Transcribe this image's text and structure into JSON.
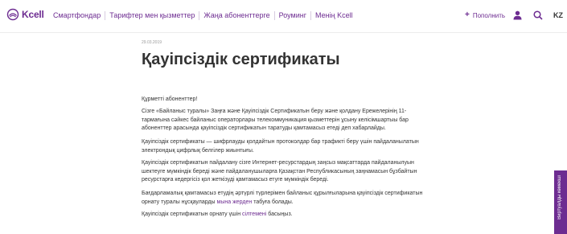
{
  "header": {
    "logo_text": "Kcell",
    "nav": [
      "Смартфондар",
      "Тарифтер мен қызметтер",
      "Жаңа абоненттерге",
      "Роуминг",
      "Менің Kcell"
    ],
    "replenish_label": "Пополнить",
    "replenish_icon": "plus-icon",
    "user_icon": "user-icon",
    "search_icon": "search-icon",
    "language": "KZ"
  },
  "article": {
    "date": "29.03.2019",
    "title": "Қауіпсіздік сертификаты",
    "greeting": "Құрметті абоненттер!",
    "p1": "Сізге «Байланыс туралы» Заңға және Қауіпсіздік Сертификатын беру және қолдану Ережелерінің 11-тармағына сәйкес байланыс операторлары телекоммуникация қызметтерін ұсыну келісімшартыы бар абоненттер арасында қауіпсіздік сертификатын таратуды қамтамасыз етеді деп хабарлайды.",
    "p2": "Қауіпсіздік сертификаты — шифрлауды қолдайтын протоколдар бар трафикті беру үшін пайдаланылатын электрондық цифрлық белгілер жиынтығы.",
    "p3": "Қауіпсіздік сертификатын пайдалану сізге Интернет-ресурстардың заңсыз мақсаттарда пайдаланылуын шектеуге мүмкіндік береді және пайдаланушыларға Қазақстан Республикасының заңнамасын бұзбайтын ресурстарға кедергісіз қол жеткізуді қамтамасыз етуге мүмкіндік береді.",
    "p4_text": "Бағдарламалық қамтамасыз етудің әртүрлі түрлерімен байланыс құрылғыларына қауіпсіздік сертификатын орнату туралы нұсқауларды ",
    "p4_link": "мына жерден",
    "p4_end": " табуға болады.",
    "p5_text": "Қауіпсіздік сертификатын орнату үшін ",
    "p5_link": "сілтемені",
    "p5_end": " басыңыз."
  },
  "side_tab": "Виртуалды көмекші",
  "colors": {
    "brand": "#6d2c91",
    "text": "#333333",
    "muted": "#9a9a9a"
  }
}
